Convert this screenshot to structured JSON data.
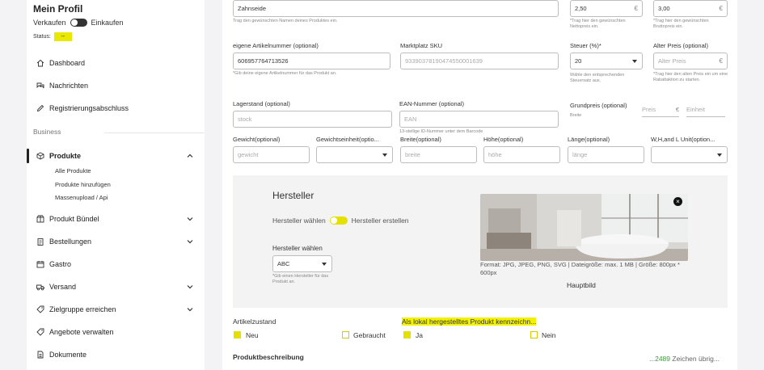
{
  "sidebar": {
    "profile_title": "Mein Profil",
    "sell_label": "Verkaufen",
    "buy_label": "Einkaufen",
    "status_label": "Status:",
    "status_value": "--",
    "section_business": "Business",
    "items": [
      {
        "label": "Dashboard",
        "icon": "home-icon"
      },
      {
        "label": "Nachrichten",
        "icon": "messages-icon"
      },
      {
        "label": "Registrierungsabschluss",
        "icon": "pen-icon"
      },
      {
        "label": "Produkte",
        "icon": "box-icon"
      },
      {
        "label": "Produkt Bündel",
        "icon": "bundle-icon"
      },
      {
        "label": "Bestellungen",
        "icon": "clipboard-icon"
      },
      {
        "label": "Gastro",
        "icon": "calendar-icon"
      },
      {
        "label": "Versand",
        "icon": "truck-icon"
      },
      {
        "label": "Zielgruppe erreichen",
        "icon": "tag-icon"
      },
      {
        "label": "Angebote verwalten",
        "icon": "tag-icon"
      },
      {
        "label": "Dokumente",
        "icon": "document-icon"
      }
    ],
    "sub_items": [
      "Alle Produkte",
      "Produkte hinzufügen",
      "Massenupload / Api"
    ]
  },
  "form": {
    "name_value": "Zahnseide",
    "name_hint": "Trag den gewünschten Namen deines Produktes ein.",
    "net_price_value": "2,50",
    "net_price_hint": "*Trag hier den gewünschten Nettopreis ein.",
    "gross_price_value": "3,00",
    "gross_price_hint": "*Trag hier den gewünschten Bruttopreis ein.",
    "currency": "€",
    "article_no_label": "eigene Artikelnummer (optional)",
    "article_no_value": "606957764713526",
    "article_no_hint": "*Gib deine eigene Artikelnummer für das Produkt an.",
    "sku_label": "Marktplatz SKU",
    "sku_value": "93390378190474550001639",
    "tax_label": "Steuer (%)*",
    "tax_value": "20",
    "tax_hint": "Wähle den entsprechenden Steuersatz aus.",
    "old_price_label": "Alter Preis (optional)",
    "old_price_placeholder": "Alter Preis",
    "old_price_hint": "*Trag hier den alten Preis ein um eine Rabattaktion zu starten.",
    "stock_label": "Lagerstand (optional)",
    "stock_placeholder": "stock",
    "ean_label": "EAN-Nummer (optional)",
    "ean_placeholder": "EAN",
    "ean_hint": "13-stellige ID-Nummer unter dem Barcode",
    "base_price_label": "Grundpreis (optional)",
    "base_price_sub": "Breite",
    "base_price_placeholder": "Preis",
    "unit_placeholder": "Einheit",
    "weight_label": "Gewicht(optional)",
    "weight_placeholder": "gewicht",
    "weight_unit_label": "Gewichtseinheit(optio...",
    "width_label": "Breite(optional)",
    "width_placeholder": "breite",
    "height_label": "Höhe(optional)",
    "height_placeholder": "höhe",
    "length_label": "Länge(optional)",
    "length_placeholder": "länge",
    "dim_unit_label": "W,H,and L Unit(option..."
  },
  "manufacturer": {
    "title": "Hersteller",
    "choose_label": "Hersteller wählen",
    "create_label": "Hersteller erstellen",
    "select_label": "Hersteller wählen",
    "select_value": "ABC",
    "select_hint": "*Gib einen Hersteller für das Produkt an.",
    "format_text": "Format: JPG, JPEG, PNG, SVG | Dateigröße: max. 1 MB | Größe: 800px * 600px",
    "main_image_label": "Hauptbild",
    "close_symbol": "×"
  },
  "condition": {
    "label": "Artikelzustand",
    "new_label": "Neu",
    "used_label": "Gebraucht"
  },
  "local": {
    "label": "Als lokal hergestelltes Produkt kennzeichn...",
    "yes_label": "Ja",
    "no_label": "Nein"
  },
  "description": {
    "label": "Produktbeschreibung",
    "counter_prefix": "...",
    "counter_value": "2489",
    "counter_suffix": "Zeichen übrig..."
  },
  "colors": {
    "accent": "#e4e000",
    "highlight": "#f2f200"
  }
}
